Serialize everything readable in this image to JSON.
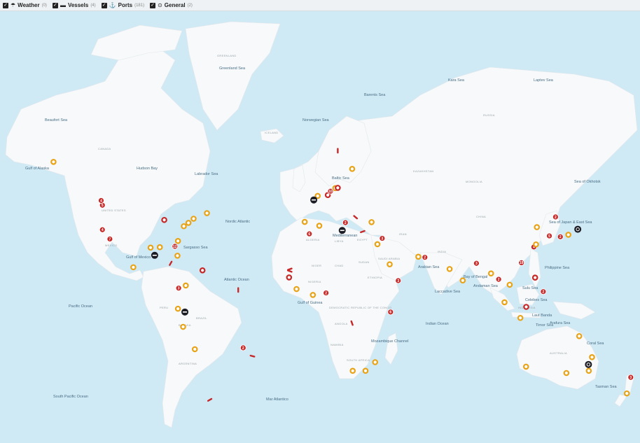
{
  "filters": [
    {
      "label": "Weather",
      "count": "(0)",
      "icon": "weather-icon",
      "glyph": "☂",
      "checked": true
    },
    {
      "label": "Vessels",
      "count": "(4)",
      "icon": "vessel-icon",
      "glyph": "▬",
      "checked": true
    },
    {
      "label": "Ports",
      "count": "(181)",
      "icon": "port-icon",
      "glyph": "⚓",
      "checked": true
    },
    {
      "label": "General",
      "count": "(2)",
      "icon": "general-icon",
      "glyph": "⊙",
      "checked": true
    }
  ],
  "colors": {
    "ocean": "#cfe9f5",
    "land": "#f7f9fa",
    "port_orange": "#e8a317",
    "port_red": "#c62828",
    "general_dark": "#1c1c24",
    "vessel_red": "#c62828"
  },
  "sea_labels": [
    "Greenland Sea",
    "Kara Sea",
    "Laptev Sea",
    "Barents Sea",
    "Beaufort Sea",
    "Norwegian Sea",
    "Hudson Bay",
    "Labrador Sea",
    "Gulf of Alaska",
    "Baltic Sea",
    "Sea of Okhotsk",
    "Sea of Japan & East Sea",
    "Nordic Atlantic",
    "Mediterranean",
    "Sargasso Sea",
    "Gulf of Mexico",
    "Atlantic Ocean",
    "Arabian Sea",
    "Bay of Bengal",
    "Philippine Sea",
    "Andaman Sea",
    "Sulu Sea",
    "Celebes Sea",
    "Laut Banda",
    "Arafura Sea",
    "Timor Sea",
    "Laccadive Sea",
    "Gulf of Guinea",
    "Pacific Ocean",
    "Indian Ocean",
    "Coral Sea",
    "Mozambique Channel",
    "Tasman Sea",
    "South Pacific Ocean",
    "Mar Atlantico"
  ],
  "place_labels": [
    "GREENLAND",
    "ICELAND",
    "CANADA",
    "UNITED STATES",
    "MEXICO",
    "BRAZIL",
    "PERU",
    "BOLIVIA",
    "ARGENTINA",
    "ALGERIA",
    "LIBYA",
    "EGYPT",
    "NIGER",
    "CHAD",
    "SUDAN",
    "ETHIOPIA",
    "NIGERIA",
    "DEMOCRATIC REPUBLIC OF THE CONGO",
    "ANGOLA",
    "NAMIBIA",
    "SOUTH AFRICA",
    "KAZAKHSTAN",
    "MONGOLIA",
    "CHINA",
    "INDIA",
    "IRAN",
    "SAUDI ARABIA",
    "AUSTRALIA",
    "INDONESIA",
    "RUSSIA"
  ],
  "markers": {
    "ports": [
      {
        "kind": "ring",
        "color": "orange",
        "lon": -149.9,
        "lat": 61.2
      },
      {
        "kind": "num",
        "color": "red",
        "lon": -122.4,
        "lat": 47.6,
        "label": "5"
      },
      {
        "kind": "num",
        "color": "red",
        "lon": -123.1,
        "lat": 49.3,
        "label": "4"
      },
      {
        "kind": "num",
        "color": "red",
        "lon": -122.4,
        "lat": 37.8,
        "label": "4"
      },
      {
        "kind": "num",
        "color": "red",
        "lon": -118.2,
        "lat": 33.7,
        "label": "7"
      },
      {
        "kind": "ring",
        "color": "orange",
        "lon": -95.3,
        "lat": 29.7
      },
      {
        "kind": "ring",
        "color": "orange",
        "lon": -90.1,
        "lat": 29.9
      },
      {
        "kind": "num",
        "color": "red",
        "lon": -81.6,
        "lat": 30.3,
        "label": "12"
      },
      {
        "kind": "ring",
        "color": "orange",
        "lon": -80.2,
        "lat": 25.8
      },
      {
        "kind": "ring",
        "color": "orange",
        "lon": -76.6,
        "lat": 39.3
      },
      {
        "kind": "ring",
        "color": "orange",
        "lon": -74.0,
        "lat": 40.7
      },
      {
        "kind": "ring",
        "color": "orange",
        "lon": -71.1,
        "lat": 42.4
      },
      {
        "kind": "ring",
        "color": "red",
        "lon": -87.6,
        "lat": 41.9
      },
      {
        "kind": "ring",
        "color": "orange",
        "lon": -79.9,
        "lat": 32.8
      },
      {
        "kind": "ring",
        "color": "orange",
        "lon": -63.6,
        "lat": 44.6
      },
      {
        "kind": "ring",
        "color": "orange",
        "lon": -105.0,
        "lat": 20.0
      },
      {
        "kind": "num",
        "color": "red",
        "lon": -79.5,
        "lat": 9.0,
        "label": "3"
      },
      {
        "kind": "ring",
        "color": "red",
        "lon": -66.1,
        "lat": 18.4
      },
      {
        "kind": "ring",
        "color": "orange",
        "lon": -75.5,
        "lat": 10.4
      },
      {
        "kind": "ring",
        "color": "orange",
        "lon": -79.9,
        "lat": -2.2
      },
      {
        "kind": "ring",
        "color": "orange",
        "lon": -77.0,
        "lat": -12.0
      },
      {
        "kind": "ring",
        "color": "orange",
        "lon": -70.4,
        "lat": -23.6
      },
      {
        "kind": "num",
        "color": "red",
        "lon": -43.2,
        "lat": -22.9,
        "label": "2"
      },
      {
        "kind": "ring",
        "color": "orange",
        "lon": -1.3,
        "lat": 50.9
      },
      {
        "kind": "ring",
        "color": "red",
        "lon": 4.4,
        "lat": 51.2
      },
      {
        "kind": "ring",
        "color": "orange",
        "lon": 8.6,
        "lat": 53.5
      },
      {
        "kind": "num",
        "color": "red",
        "lon": 5.9,
        "lat": 52.5,
        "label": "10"
      },
      {
        "kind": "ring",
        "color": "red",
        "lon": 10.0,
        "lat": 53.6
      },
      {
        "kind": "ring",
        "color": "orange",
        "lon": 18.1,
        "lat": 59.3
      },
      {
        "kind": "ring",
        "color": "orange",
        "lon": -8.6,
        "lat": 41.1
      },
      {
        "kind": "ring",
        "color": "orange",
        "lon": -0.4,
        "lat": 39.5
      },
      {
        "kind": "num",
        "color": "red",
        "lon": 14.3,
        "lat": 40.8,
        "label": "2"
      },
      {
        "kind": "num",
        "color": "red",
        "lon": -6.0,
        "lat": 36.0,
        "label": "6"
      },
      {
        "kind": "ring",
        "color": "orange",
        "lon": 29.0,
        "lat": 41.0
      },
      {
        "kind": "ring",
        "color": "orange",
        "lon": 32.3,
        "lat": 31.3
      },
      {
        "kind": "num",
        "color": "red",
        "lon": 35.0,
        "lat": 34.0,
        "label": "3"
      },
      {
        "kind": "ring",
        "color": "orange",
        "lon": 39.2,
        "lat": 21.5
      },
      {
        "kind": "num",
        "color": "red",
        "lon": 44.0,
        "lat": 13.0,
        "label": "3"
      },
      {
        "kind": "ring",
        "color": "orange",
        "lon": 55.3,
        "lat": 25.3
      },
      {
        "kind": "num",
        "color": "red",
        "lon": 59.0,
        "lat": 25.0,
        "label": "2"
      },
      {
        "kind": "ring",
        "color": "orange",
        "lon": 72.9,
        "lat": 19.1
      },
      {
        "kind": "ring",
        "color": "orange",
        "lon": 80.3,
        "lat": 13.1
      },
      {
        "kind": "num",
        "color": "red",
        "lon": 88.0,
        "lat": 22.0,
        "label": "3"
      },
      {
        "kind": "ring",
        "color": "orange",
        "lon": 96.2,
        "lat": 16.8
      },
      {
        "kind": "num",
        "color": "red",
        "lon": 100.5,
        "lat": 13.7,
        "label": "2"
      },
      {
        "kind": "ring",
        "color": "orange",
        "lon": 103.8,
        "lat": 1.3
      },
      {
        "kind": "ring",
        "color": "orange",
        "lon": 106.7,
        "lat": 10.8
      },
      {
        "kind": "num",
        "color": "red",
        "lon": 113.3,
        "lat": 22.3,
        "label": "19"
      },
      {
        "kind": "num",
        "color": "red",
        "lon": 120.3,
        "lat": 30.0,
        "label": "4"
      },
      {
        "kind": "ring",
        "color": "orange",
        "lon": 121.5,
        "lat": 31.2
      },
      {
        "kind": "ring",
        "color": "orange",
        "lon": 122.0,
        "lat": 38.9
      },
      {
        "kind": "num",
        "color": "red",
        "lon": 129.0,
        "lat": 35.1,
        "label": "5"
      },
      {
        "kind": "num",
        "color": "red",
        "lon": 132.5,
        "lat": 43.1,
        "label": "2"
      },
      {
        "kind": "ring",
        "color": "orange",
        "lon": 139.7,
        "lat": 35.6
      },
      {
        "kind": "num",
        "color": "red",
        "lon": 135.2,
        "lat": 34.7,
        "label": "2"
      },
      {
        "kind": "ring",
        "color": "red",
        "lon": 121.0,
        "lat": 14.6
      },
      {
        "kind": "ring",
        "color": "orange",
        "lon": 112.7,
        "lat": -7.2
      },
      {
        "kind": "ring",
        "color": "red",
        "lon": 116.0,
        "lat": -1.2
      },
      {
        "kind": "num",
        "color": "red",
        "lon": 125.6,
        "lat": 7.1,
        "label": "2"
      },
      {
        "kind": "ring",
        "color": "orange",
        "lon": 115.9,
        "lat": -32.0
      },
      {
        "kind": "ring",
        "color": "orange",
        "lon": 138.6,
        "lat": -34.9
      },
      {
        "kind": "ring",
        "color": "orange",
        "lon": 151.2,
        "lat": -33.9
      },
      {
        "kind": "ring",
        "color": "orange",
        "lon": 153.0,
        "lat": -27.5
      },
      {
        "kind": "ring",
        "color": "orange",
        "lon": 145.8,
        "lat": -16.9
      },
      {
        "kind": "num",
        "color": "red",
        "lon": 174.8,
        "lat": -36.8,
        "label": "3"
      },
      {
        "kind": "ring",
        "color": "orange",
        "lon": 172.6,
        "lat": -43.5
      },
      {
        "kind": "ring",
        "color": "red",
        "lon": -17.4,
        "lat": 14.7
      },
      {
        "kind": "ring",
        "color": "orange",
        "lon": -13.2,
        "lat": 8.5
      },
      {
        "kind": "num",
        "color": "red",
        "lon": 3.4,
        "lat": 6.4,
        "label": "2"
      },
      {
        "kind": "ring",
        "color": "orange",
        "lon": -4.0,
        "lat": 5.3
      },
      {
        "kind": "num",
        "color": "red",
        "lon": 39.7,
        "lat": -4.0,
        "label": "6"
      },
      {
        "kind": "ring",
        "color": "orange",
        "lon": 18.4,
        "lat": -33.9
      },
      {
        "kind": "ring",
        "color": "orange",
        "lon": 25.6,
        "lat": -33.9
      },
      {
        "kind": "ring",
        "color": "orange",
        "lon": 31.0,
        "lat": -29.9
      }
    ],
    "general": [
      {
        "lon": 145.0,
        "lat": 38.0
      },
      {
        "lon": 151.0,
        "lat": -31.0
      }
    ],
    "vessels": [
      {
        "lon": -3.5,
        "lat": 49.5
      },
      {
        "lon": -93.0,
        "lat": 26.0
      },
      {
        "lon": 12.5,
        "lat": 37.5
      },
      {
        "lon": -76.0,
        "lat": -4.0
      }
    ],
    "vessel_tracks": [
      {
        "lon": -84.0,
        "lat": 22.0,
        "rot": -60
      },
      {
        "lon": -17.0,
        "lat": 19.0,
        "rot": -20
      },
      {
        "lon": -17.0,
        "lat": 18.0,
        "rot": 20
      },
      {
        "lon": -46.0,
        "lat": 8.0,
        "rot": 90
      },
      {
        "lon": -62.0,
        "lat": -46.0,
        "rot": -30
      },
      {
        "lon": -38.0,
        "lat": -27.0,
        "rot": 15
      },
      {
        "lon": 10.0,
        "lat": 64.0,
        "rot": 90
      },
      {
        "lon": 20.0,
        "lat": 43.0,
        "rot": 40
      },
      {
        "lon": 24.0,
        "lat": 37.0,
        "rot": -20
      },
      {
        "lon": 18.0,
        "lat": -10.0,
        "rot": 70
      }
    ]
  },
  "projection": {
    "lon_min": -180,
    "lon_max": 180,
    "lat_max": 83,
    "lat_min": -60
  }
}
